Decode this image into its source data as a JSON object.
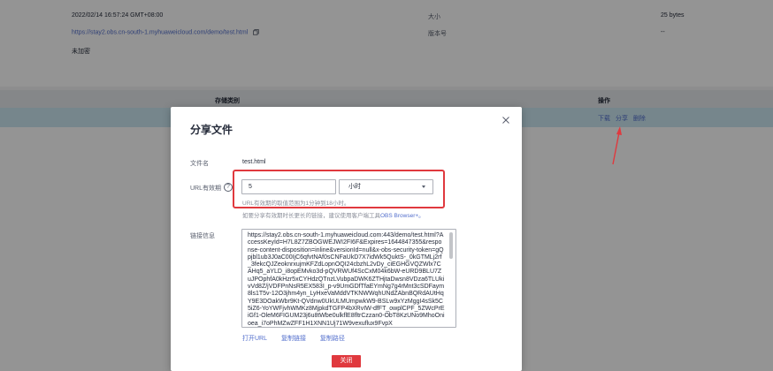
{
  "background": {
    "timestamp": "2022/02/14 16:57:24 GMT+08:00",
    "url": "https://stay2.obs.cn-south-1.myhuaweicloud.com/demo/test.html",
    "encryption": "未加密",
    "size_label": "大小",
    "size_value": "25 bytes",
    "version_label": "版本号",
    "version_value": "--",
    "table_header_storage": "存储类别",
    "table_header_actions": "操作",
    "row_actions": [
      "下载",
      "分享",
      "删除"
    ]
  },
  "dialog": {
    "title": "分享文件",
    "file_name_label": "文件名",
    "file_name": "test.html",
    "validity_label": "URL有效期",
    "help_glyph": "?",
    "validity_value": "5",
    "validity_unit": "小时",
    "range_hint": "URL有效期的取值范围为1分钟到18小时。",
    "tool_hint_prefix": "如要分享有效期时长更长的链接，建议使用客户端工具",
    "tool_hint_link": "OBS Browser+。",
    "link_label": "链接信息",
    "link_text": "https://stay2.obs.cn-south-1.myhuaweicloud.com:443/demo/test.html?AccessKeyId=H7L8Z7ZBOGWEJWI2FI6F&Expires=1644847355&response-content-disposition=inline&versionId=null&x-obs-security-token=gQpjbl1ub3J0aC00IjC6qfvtNAf0sCNFaUkD7X7idWk5QuktS-_0kGTMLj2rf_3fekcQJZeoknrxujmKFZdLopnOQI24cbzhL2vDy_ciEGHGVQZWlx7CAHq5_aYLD_i8opEMvko3d-pQVRWUf4ScCxM04k6bW-eURD9BLU7ZuJPOphfA0kHzr5xCYHdzQTnzLVubpaDWK6ZTHjtaDwsn8VDza6TLUkivVd8Z/jVDFPnNsR5EX583I_p-v9UmGDfTfaEYmNg7g4rMnt3cSDFaym8ls1T5v-12O3jhm4yn_LyHxeVaMddVTKNWWqhUNdZAbnBQRdAUtHqY9E3DOakWbr9Kt-QVdnw0UkULMUmpwkW9-BSLw9xYzMggI4sSk5C5iZ6-YoYWFjvhWMKz8MjpkdTGFP4bXRvIW-dfFT_owplCPF_5ZWcPrEiGf1-OleM6FIGUM23j6u8tWbe0ulkflE8fltrCzzan0-ObT8KzUNo9MhoOnioea_i7oPhMZwZFF1H1XNN1Uj71W9vexuflux9FvpX",
    "actions": [
      "打开URL",
      "复制链接",
      "复制路径"
    ],
    "close_button": "关闭"
  }
}
